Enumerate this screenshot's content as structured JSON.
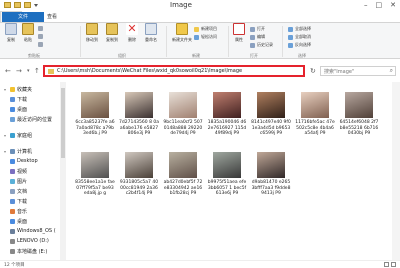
{
  "window": {
    "title": "Image"
  },
  "tabs": [
    {
      "label": "文件",
      "style": "file"
    },
    {
      "label": "主页",
      "style": "active"
    },
    {
      "label": "共享",
      "style": ""
    },
    {
      "label": "查看",
      "style": ""
    }
  ],
  "ribbon": {
    "copy": "复制",
    "paste": "粘贴",
    "move_to": "移动到",
    "copy_to": "复制到",
    "delete": "删除",
    "rename": "重命名",
    "new_folder": "新建文件夹",
    "new_item": "新建项目",
    "easy_access": "轻松访问",
    "properties": "属性",
    "open": "打开",
    "edit": "编辑",
    "history": "历史记录",
    "select_all": "全部选择",
    "select_none": "全部取消",
    "invert_selection": "反向选择",
    "groups": {
      "clipboard": "剪贴板",
      "organize": "组织",
      "new": "新建",
      "open": "打开",
      "select": "选择"
    }
  },
  "address": {
    "path": "C:\\Users\\msh\\Documents\\WeChat Files\\wxid_qk0sowoil0q21\\Image\\Image",
    "search_placeholder": "搜索\"Image\""
  },
  "nav": {
    "items": [
      {
        "label": "收藏夹",
        "level": 0,
        "color": "#f2c230"
      },
      {
        "label": "下载",
        "level": 1,
        "color": "#5a8fd8"
      },
      {
        "label": "桌面",
        "level": 1,
        "color": "#4a8be0"
      },
      {
        "label": "最近访问的位置",
        "level": 1,
        "color": "#6aa0d8"
      },
      {
        "label": "家庭组",
        "level": 0,
        "color": "#3aa0d0"
      },
      {
        "label": "计算机",
        "level": 0,
        "color": "#6b8fb8"
      },
      {
        "label": "Desktop",
        "level": 1,
        "color": "#4a8be0"
      },
      {
        "label": "视频",
        "level": 1,
        "color": "#7b6fc0"
      },
      {
        "label": "图片",
        "level": 1,
        "color": "#5ab0d8"
      },
      {
        "label": "文档",
        "level": 1,
        "color": "#8aa0c0"
      },
      {
        "label": "下载",
        "level": 1,
        "color": "#5a8fd8"
      },
      {
        "label": "音乐",
        "level": 1,
        "color": "#e07a3a"
      },
      {
        "label": "桌面",
        "level": 1,
        "color": "#4a8be0"
      },
      {
        "label": "Windows8_OS (",
        "level": 1,
        "color": "#6a7f9a"
      },
      {
        "label": "LENOVO (D:)",
        "level": 1,
        "color": "#888888"
      },
      {
        "label": "本地磁盘 (E:)",
        "level": 1,
        "color": "#888888"
      }
    ]
  },
  "files": [
    {
      "name": "6cc3a85237fe a67a0ad878c a79b3ed6b.j P9",
      "colors": [
        "#c8b8a0",
        "#6a5040"
      ]
    },
    {
      "name": "7d27143560 8 0aa6abe176 e5827806e3j P9",
      "colors": [
        "#d8c8b8",
        "#3a3030"
      ]
    },
    {
      "name": "9bc11ea0cf2 5070148a888 29220de79d4j P9",
      "colors": [
        "#e8e0d8",
        "#a08070"
      ]
    },
    {
      "name": "1835a190046 d62e7616927 115d49f89dj P9",
      "colors": [
        "#c08070",
        "#402020"
      ]
    },
    {
      "name": "8141c497e40 9f01e3a4d5d b9653c6599j P9",
      "colors": [
        "#b08060",
        "#302018"
      ]
    },
    {
      "name": "11716bfe5ac 47e502c5c8e 4b4a6a54afj P9",
      "colors": [
        "#e8d0c0",
        "#806050"
      ]
    },
    {
      "name": "64514ef6048 2f7b8e55218 6b7160430bj P9",
      "colors": [
        "#b8a8a0",
        "#504038"
      ]
    },
    {
      "name": "83558ee1a1e fae07ff79f5a7 be93eda8j.jp g",
      "colors": [
        "#c8c0b8",
        "#505050"
      ]
    },
    {
      "name": "9331805c5a7 4000cc81949 2a36c2b4f14j P9",
      "colors": [
        "#d0c8c0",
        "#4a4038"
      ]
    },
    {
      "name": "ab427d0ebf5f 72e83304942 ae16b1fb28cj P9",
      "colors": [
        "#b8b0a0",
        "#605048"
      ]
    },
    {
      "name": "b9975f51aea efe3bb6057 1 bec5f613e6j P9",
      "colors": [
        "#a0a8a0",
        "#383838"
      ]
    },
    {
      "name": "d9ab81470 e2653bfff7aa3 f9dde89413j P9",
      "colors": [
        "#c0a898",
        "#302828"
      ]
    }
  ],
  "status": {
    "text": "12 个项目"
  }
}
